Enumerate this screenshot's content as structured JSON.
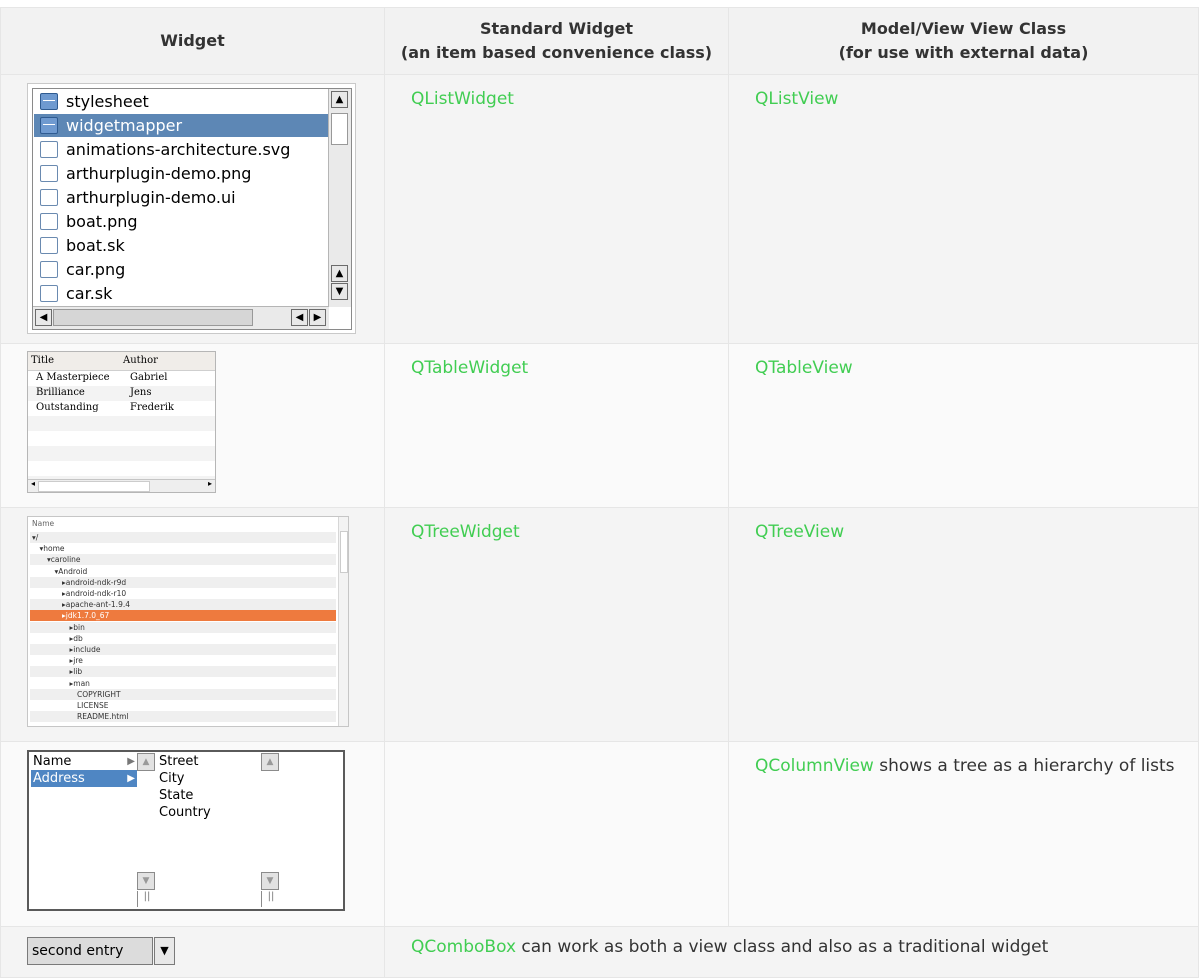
{
  "header": {
    "col1": "Widget",
    "col2_line1": "Standard Widget",
    "col2_line2": "(an item based convenience class)",
    "col3_line1": "Model/View View Class",
    "col3_line2": "(for use with external data)"
  },
  "rows": {
    "list": {
      "standard": "QListWidget",
      "view": "QListView"
    },
    "table": {
      "standard": "QTableWidget",
      "view": "QTableView"
    },
    "tree": {
      "standard": "QTreeWidget",
      "view": "QTreeView"
    },
    "column": {
      "view_link": "QColumnView",
      "view_text": " shows a tree as a hierarchy of lists"
    },
    "combo": {
      "standard_link": "QComboBox",
      "standard_text": " can work as both a view class and also as a traditional widget"
    }
  },
  "list_widget": {
    "items": [
      {
        "label": "stylesheet",
        "icon": "folder-icon"
      },
      {
        "label": "widgetmapper",
        "icon": "folder-icon",
        "selected": true
      },
      {
        "label": "animations-architecture.svg",
        "icon": "file-icon"
      },
      {
        "label": "arthurplugin-demo.png",
        "icon": "file-icon"
      },
      {
        "label": "arthurplugin-demo.ui",
        "icon": "file-icon"
      },
      {
        "label": "boat.png",
        "icon": "file-icon"
      },
      {
        "label": "boat.sk",
        "icon": "file-icon"
      },
      {
        "label": "car.png",
        "icon": "file-icon"
      },
      {
        "label": "car.sk",
        "icon": "file-icon"
      }
    ]
  },
  "table_widget": {
    "headers": [
      "Title",
      "Author"
    ],
    "rows": [
      [
        "A Masterpiece",
        "Gabriel"
      ],
      [
        "Brilliance",
        "Jens"
      ],
      [
        "Outstanding",
        "Frederik"
      ]
    ]
  },
  "tree_widget": {
    "header": "Name",
    "rows": [
      {
        "label": "▾/",
        "indent": 0
      },
      {
        "label": "▾home",
        "indent": 1
      },
      {
        "label": "▾caroline",
        "indent": 2
      },
      {
        "label": "▾Android",
        "indent": 3
      },
      {
        "label": "▸android-ndk-r9d",
        "indent": 4
      },
      {
        "label": "▸android-ndk-r10",
        "indent": 4
      },
      {
        "label": "▸apache-ant-1.9.4",
        "indent": 4
      },
      {
        "label": "▸jdk1.7.0_67",
        "indent": 4,
        "selected": true
      },
      {
        "label": "▸bin",
        "indent": 5
      },
      {
        "label": "▸db",
        "indent": 5
      },
      {
        "label": "▸include",
        "indent": 5
      },
      {
        "label": "▸jre",
        "indent": 5
      },
      {
        "label": "▸lib",
        "indent": 5
      },
      {
        "label": "▸man",
        "indent": 5
      },
      {
        "label": "COPYRIGHT",
        "indent": 6
      },
      {
        "label": "LICENSE",
        "indent": 6
      },
      {
        "label": "README.html",
        "indent": 6
      }
    ]
  },
  "column_view": {
    "col1": [
      "Name",
      "Address"
    ],
    "col2": [
      "Street",
      "City",
      "State",
      "Country"
    ]
  },
  "combo_box": {
    "value": "second entry"
  }
}
